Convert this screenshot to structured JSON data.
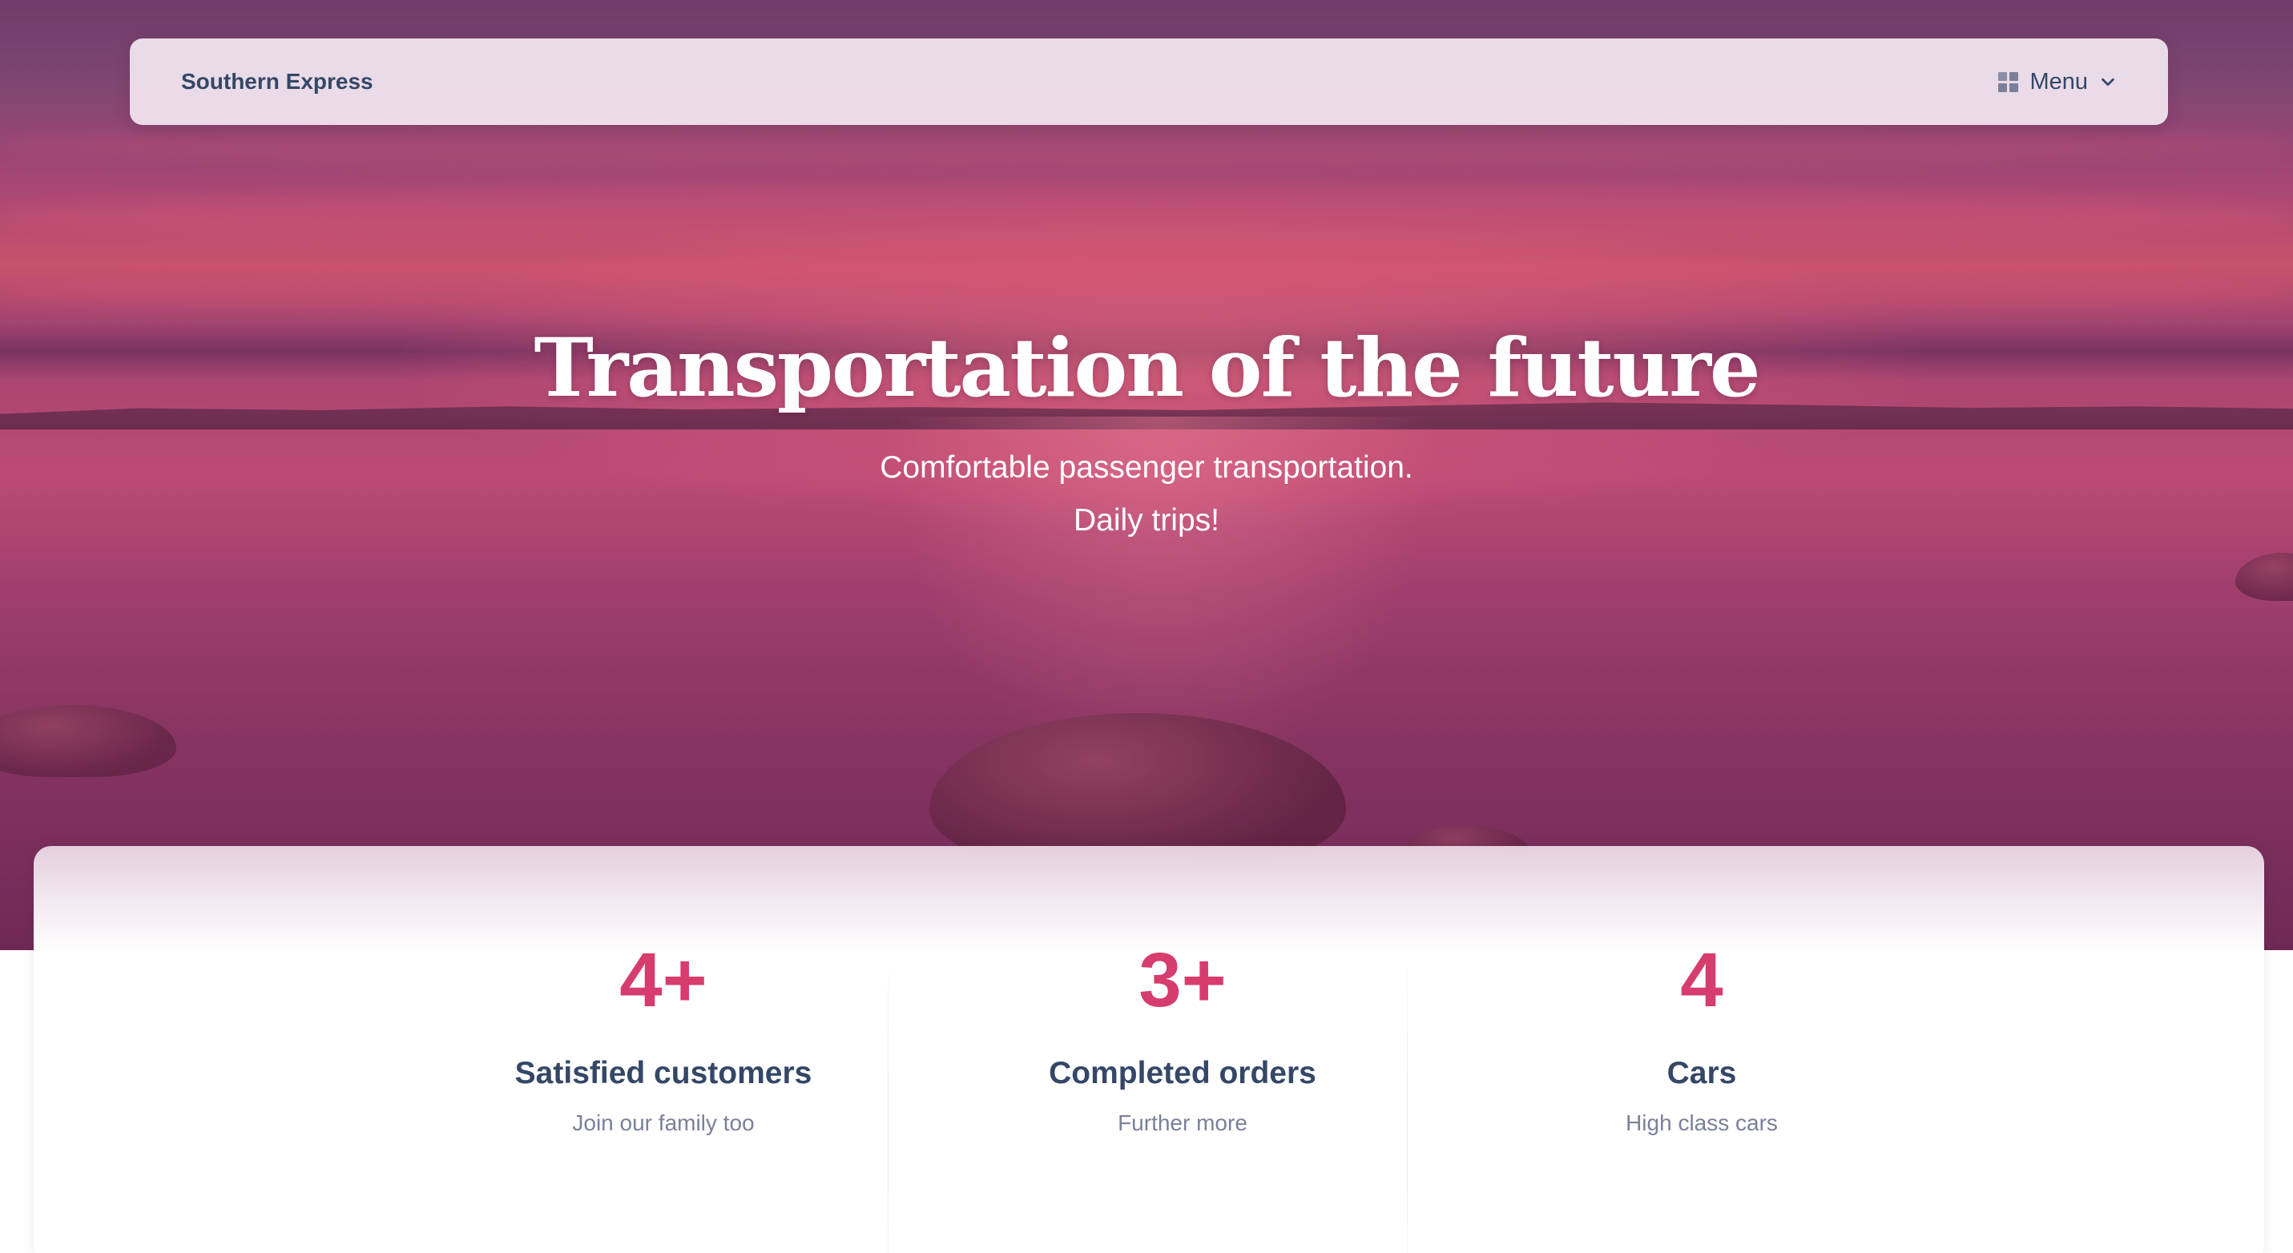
{
  "navbar": {
    "brand": "Southern Express",
    "menu_label": "Menu",
    "menu_icon": "grid-icon",
    "dropdown_icon": "chevron-down-icon"
  },
  "hero": {
    "title": "Transportation of the future",
    "subtitle_line1": "Comfortable passenger transportation.",
    "subtitle_line2": "Daily trips!"
  },
  "stats": [
    {
      "number": "4+",
      "title": "Satisfied customers",
      "description": "Join our family too"
    },
    {
      "number": "3+",
      "title": "Completed orders",
      "description": "Further more"
    },
    {
      "number": "4",
      "title": "Cars",
      "description": "High class cars"
    }
  ],
  "colors": {
    "accent": "#d63d6e",
    "heading": "#344767",
    "muted": "#7b809a"
  }
}
